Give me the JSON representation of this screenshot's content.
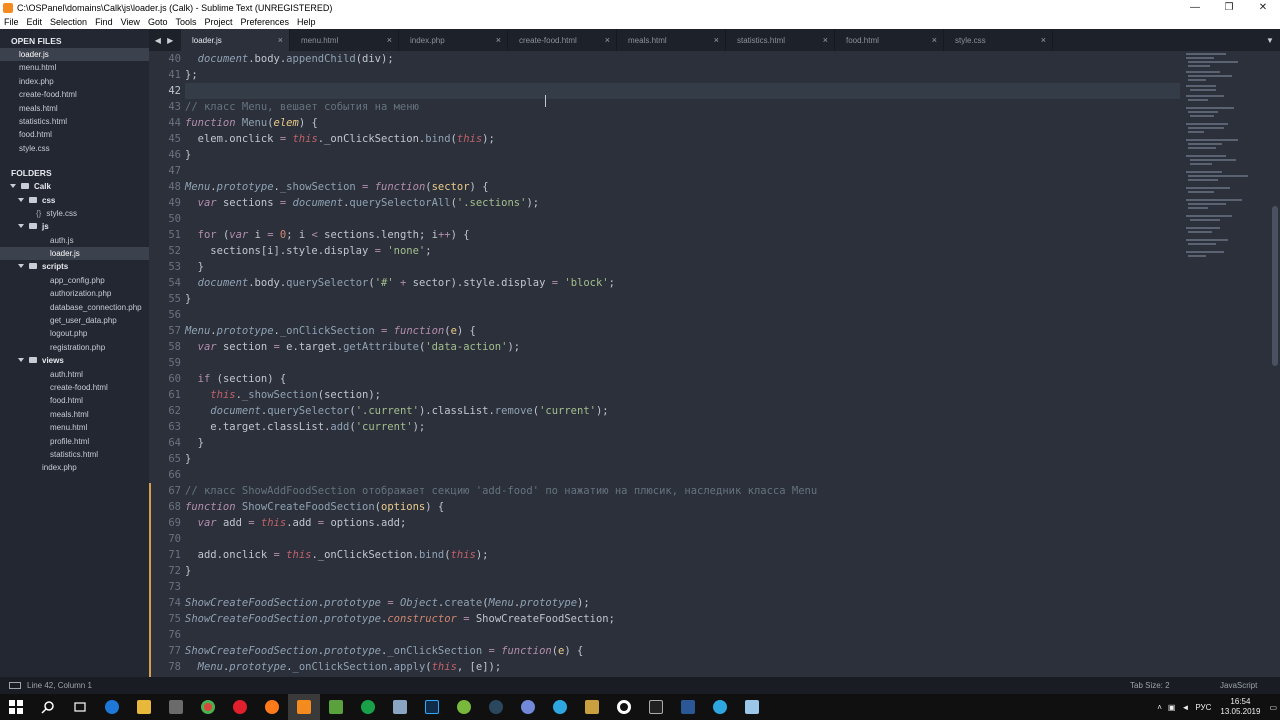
{
  "window": {
    "title": "C:\\OSPanel\\domains\\Calk\\js\\loader.js (Calk) - Sublime Text (UNREGISTERED)",
    "minimize": "—",
    "maximize": "❐",
    "close": "✕"
  },
  "menu": [
    "File",
    "Edit",
    "Selection",
    "Find",
    "View",
    "Goto",
    "Tools",
    "Project",
    "Preferences",
    "Help"
  ],
  "sidebar": {
    "open_files_label": "OPEN FILES",
    "open_files": [
      "loader.js",
      "menu.html",
      "index.php",
      "create-food.html",
      "meals.html",
      "statistics.html",
      "food.html",
      "style.css"
    ],
    "folders_label": "FOLDERS",
    "tree": {
      "root": "Calk",
      "css": "css",
      "css_files": [
        "style.css"
      ],
      "js": "js",
      "js_files": [
        "auth.js",
        "loader.js"
      ],
      "scripts": "scripts",
      "scripts_files": [
        "app_config.php",
        "authorization.php",
        "database_connection.php",
        "get_user_data.php",
        "logout.php",
        "registration.php"
      ],
      "views": "views",
      "views_files": [
        "auth.html",
        "create-food.html",
        "food.html",
        "meals.html",
        "menu.html",
        "profile.html",
        "statistics.html"
      ],
      "root_files": [
        "index.php"
      ]
    }
  },
  "tabs": [
    "loader.js",
    "menu.html",
    "index.php",
    "create-food.html",
    "meals.html",
    "statistics.html",
    "food.html",
    "style.css"
  ],
  "tab_nav": "◀ ▶",
  "tab_close": "×",
  "tab_menu": "▼",
  "editor": {
    "line_numbers": [
      "40",
      "41",
      "42",
      "43",
      "44",
      "45",
      "46",
      "47",
      "48",
      "49",
      "50",
      "51",
      "52",
      "53",
      "54",
      "55",
      "56",
      "57",
      "58",
      "59",
      "60",
      "61",
      "62",
      "63",
      "64",
      "65",
      "66",
      "67",
      "68",
      "69",
      "70",
      "71",
      "72",
      "73",
      "74",
      "75",
      "76",
      "77",
      "78"
    ],
    "comments": {
      "c43": "// класс Menu, вешает события на меню",
      "c67": "// класс ShowAddFoodSection отображает секцию 'add-food' по нажатию на плюсик, наследник класса Menu"
    }
  },
  "status": {
    "position": "Line 42, Column 1",
    "tab_size": "Tab Size: 2",
    "syntax": "JavaScript"
  },
  "taskbar": {
    "lang": "РУС",
    "time": "16:54",
    "date": "13.05.2019"
  },
  "colors": {
    "editor_bg": "#2b303b",
    "sidebar_bg": "#222731",
    "accent_mod": "#d0a050"
  }
}
